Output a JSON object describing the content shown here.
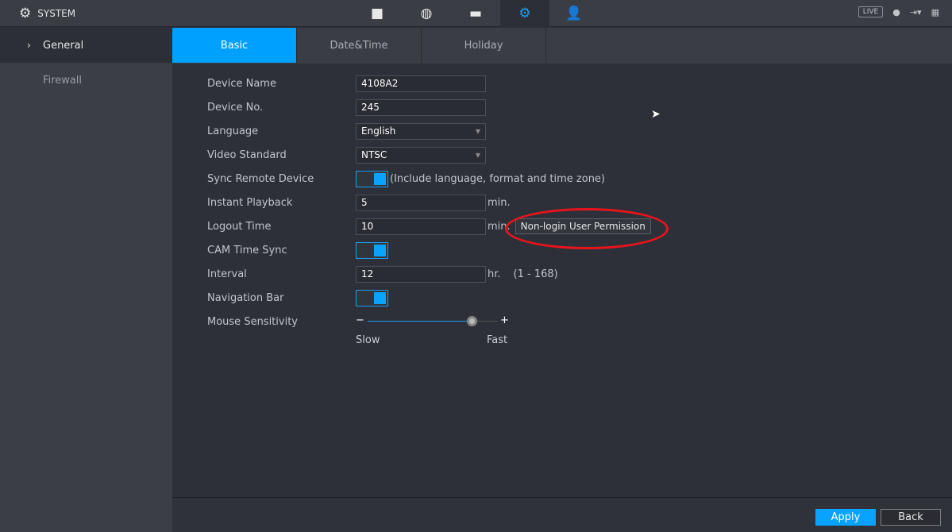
{
  "header": {
    "title": "SYSTEM",
    "nav_icons": [
      "camera-icon",
      "network-icon",
      "storage-icon",
      "system-gears-icon",
      "account-icon"
    ],
    "active_nav": "system-gears-icon",
    "live_label": "LIVE"
  },
  "sidebar": {
    "items": [
      {
        "label": "General",
        "active": true
      },
      {
        "label": "Firewall",
        "active": false
      }
    ]
  },
  "tabs": [
    {
      "label": "Basic",
      "active": true
    },
    {
      "label": "Date&Time"
    },
    {
      "label": "Holiday"
    }
  ],
  "form": {
    "device_name": {
      "label": "Device Name",
      "value": "4108A2"
    },
    "device_no": {
      "label": "Device No.",
      "value": "245"
    },
    "language": {
      "label": "Language",
      "value": "English"
    },
    "video_standard": {
      "label": "Video Standard",
      "value": "NTSC"
    },
    "sync_remote": {
      "label": "Sync Remote Device",
      "on": true,
      "note": "(Include language, format and time zone)"
    },
    "instant_playback": {
      "label": "Instant Playback",
      "value": "5",
      "unit": "min."
    },
    "logout_time": {
      "label": "Logout Time",
      "value": "10",
      "unit": "min.",
      "button": "Non-login User Permission"
    },
    "cam_time_sync": {
      "label": "CAM Time Sync",
      "on": true
    },
    "interval": {
      "label": "Interval",
      "value": "12",
      "unit": "hr.",
      "range": "(1 - 168)"
    },
    "navigation_bar": {
      "label": "Navigation Bar",
      "on": true
    },
    "mouse_sensitivity": {
      "label": "Mouse Sensitivity",
      "level_fraction": 0.8,
      "minus": "−",
      "plus": "+",
      "slow": "Slow",
      "fast": "Fast"
    }
  },
  "footer": {
    "apply": "Apply",
    "back": "Back"
  },
  "colors": {
    "accent": "#0aa2ff",
    "annotation": "#e8141c"
  }
}
